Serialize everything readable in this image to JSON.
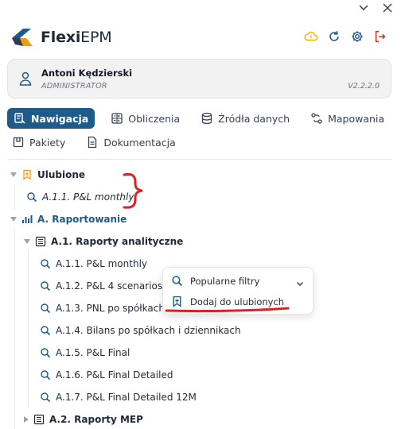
{
  "brand": {
    "name_bold": "Flexi",
    "name_light": "EPM"
  },
  "user": {
    "name": "Antoni Kędzierski",
    "role": "ADMINISTRATOR",
    "version": "V2.2.2.0"
  },
  "tabs": [
    {
      "label": "Nawigacja",
      "icon": "navigation-icon",
      "active": true
    },
    {
      "label": "Obliczenia",
      "icon": "calculator-icon"
    },
    {
      "label": "Źródła danych",
      "icon": "database-icon"
    },
    {
      "label": "Mapowania",
      "icon": "mapping-icon"
    },
    {
      "label": "Pakiety",
      "icon": "package-icon"
    },
    {
      "label": "Dokumentacja",
      "icon": "document-icon"
    }
  ],
  "tree": {
    "favorites": {
      "label": "Ulubione",
      "items": [
        "A.1.1. P&L monthly"
      ]
    },
    "reporting": {
      "label": "A. Raportowanie"
    },
    "analytic": {
      "label": "A.1. Raporty analityczne",
      "items": [
        "A.1.1. P&L monthly",
        "A.1.2. P&L 4 scenarios",
        "A.1.3. PNL po spółkach i",
        "A.1.4. Bilans po spółkach i dziennikach",
        "A.1.5. P&L Final",
        "A.1.6. P&L Final Detailed",
        "A.1.7. P&L Final Detailed 12M"
      ]
    },
    "mep": {
      "label": "A.2. Raporty MEP"
    }
  },
  "context_menu": {
    "popular_filters": "Popularne filtry",
    "add_to_favorites": "Dodaj do ulubionych"
  },
  "colors": {
    "accent": "#1e5a8a",
    "warning": "#f5b400",
    "logout": "#c0392b",
    "annotation": "#e02020"
  }
}
